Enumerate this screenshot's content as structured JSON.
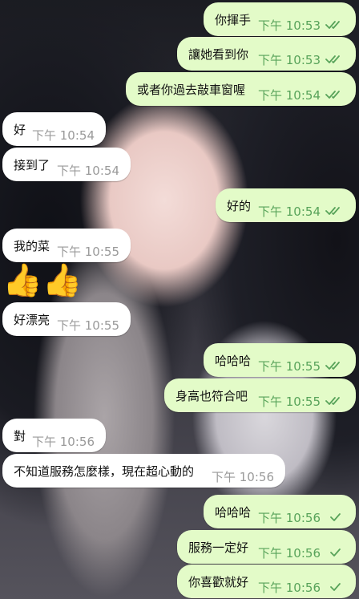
{
  "colors": {
    "outgoing_bubble": "#e3fbc8",
    "incoming_bubble": "#ffffff",
    "outgoing_time": "#58a35a",
    "incoming_time": "#9a9a9a"
  },
  "messages": [
    {
      "dir": "out",
      "text": "你揮手",
      "time": "下午 10:53",
      "status": "read"
    },
    {
      "dir": "out",
      "text": "讓她看到你",
      "time": "下午 10:53",
      "status": "read"
    },
    {
      "dir": "out",
      "text": "或者你過去敲車窗喔",
      "time": "下午 10:54",
      "status": "read"
    },
    {
      "dir": "in",
      "text": "好",
      "time": "下午 10:54"
    },
    {
      "dir": "in",
      "text": "接到了",
      "time": "下午 10:54"
    },
    {
      "dir": "out",
      "text": "好的",
      "time": "下午 10:54",
      "status": "read"
    },
    {
      "dir": "in",
      "text": "我的菜",
      "time": "下午 10:55"
    },
    {
      "dir": "in",
      "text": "好漂亮",
      "time": "下午 10:55"
    },
    {
      "dir": "out",
      "text": "哈哈哈",
      "time": "下午 10:55",
      "status": "read"
    },
    {
      "dir": "out",
      "text": "身高也符合吧",
      "time": "下午 10:55",
      "status": "read"
    },
    {
      "dir": "in",
      "text": "對",
      "time": "下午 10:56"
    },
    {
      "dir": "in",
      "text": "不知道服務怎麼樣，現在超心動的",
      "time": "下午 10:56"
    },
    {
      "dir": "out",
      "text": "哈哈哈",
      "time": "下午 10:56",
      "status": "delivered"
    },
    {
      "dir": "out",
      "text": "服務一定好",
      "time": "下午 10:56",
      "status": "delivered"
    },
    {
      "dir": "out",
      "text": "你喜歡就好",
      "time": "下午 10:56",
      "status": "delivered"
    }
  ],
  "sticker": {
    "emoji": "👍👍",
    "icon": "thumbs-up-icon"
  }
}
